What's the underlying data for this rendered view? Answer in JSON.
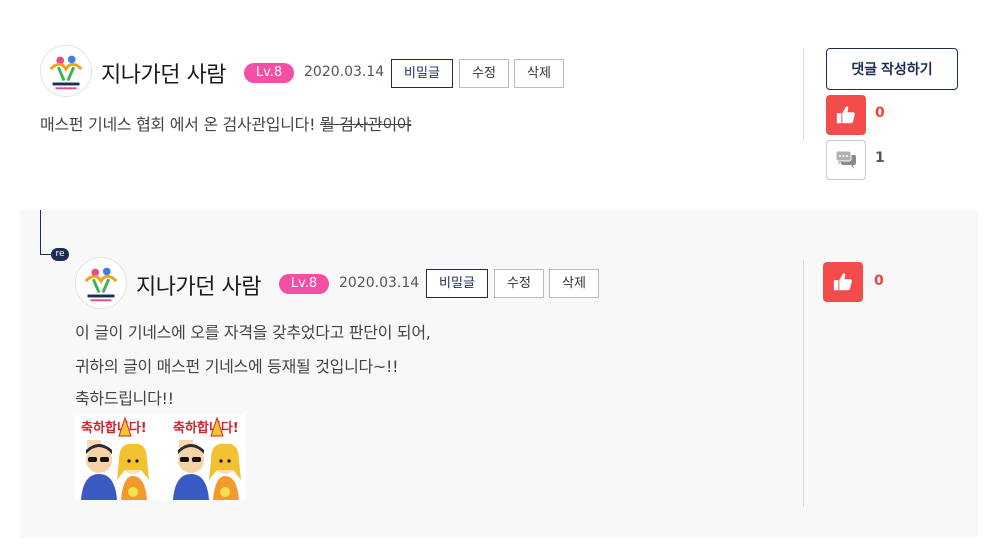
{
  "comment": {
    "author": "지나가던 사람",
    "level": "Lv.8",
    "date": "2020.03.14",
    "actions": {
      "secret": "비밀글",
      "edit": "수정",
      "delete": "삭제"
    },
    "text_main": "매스펀 기네스 협회 에서 온 검사관입니다!",
    "text_struck": "뭘 검사관이야",
    "reply_button": "댓글 작성하기",
    "likes": "0",
    "comments": "1"
  },
  "reply": {
    "badge": "re",
    "author": "지나가던 사람",
    "level": "Lv.8",
    "date": "2020.03.14",
    "actions": {
      "secret": "비밀글",
      "edit": "수정",
      "delete": "삭제"
    },
    "lines": [
      "이 글이 기네스에 오를 자격을 갖추었다고 판단이 되어,",
      "귀하의 글이 매스펀 기네스에 등재될 것입니다~!!",
      "축하드립니다!!"
    ],
    "sticker_text": "축하합니다!",
    "likes": "0"
  },
  "colors": {
    "navy": "#1d2c55",
    "level_pink": "#f24fa5",
    "like_red": "#f44b4b",
    "reply_bg": "#f8f8f8"
  },
  "icons": [
    "thumbs-up-icon",
    "speech-bubbles-icon",
    "avatar-logo"
  ]
}
